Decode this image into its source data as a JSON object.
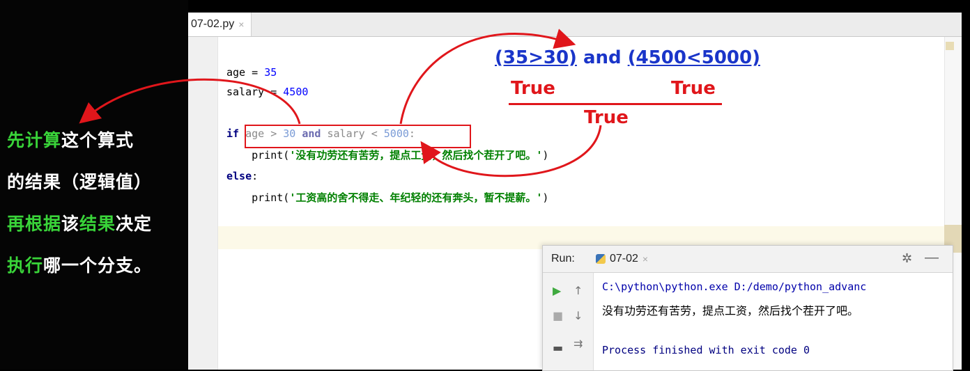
{
  "caption": {
    "line1": {
      "hl": "先计算",
      "rest": "这个算式"
    },
    "line2": {
      "text": "的结果（逻辑值）"
    },
    "line3": {
      "hl1": "再根据",
      "mid": "该",
      "hl2": "结果",
      "rest": "决定"
    },
    "line4": {
      "hl": "执行",
      "rest": "哪一个分支。"
    }
  },
  "editor": {
    "tab_label": "07-02.py",
    "tab_close": "×",
    "lines": {
      "l1_var": "age = ",
      "l1_num": "35",
      "l2_var": "salary = ",
      "l2_num": "4500",
      "l3_if": "if",
      "l3_c1": "age > ",
      "l3_n1": "30",
      "l3_and": " and ",
      "l3_c2": "salary < ",
      "l3_n2": "5000",
      "l3_colon": ":",
      "l4_print": "    print(",
      "l4_str": "'没有功劳还有苦劳，提点工资，然后找个茬开了吧。'",
      "l4_end": ")",
      "l5_else": "else",
      "l5_colon": ":",
      "l6_print": "    print(",
      "l6_str": "'工资高的舍不得走、年纪轻的还有奔头，暂不提薪。'",
      "l6_end": ")"
    }
  },
  "annotations": {
    "expr1": "(35>30)",
    "and": " and ",
    "expr2": "(4500<5000)",
    "true1": "True",
    "true2": "True",
    "true3": "True"
  },
  "run_panel": {
    "label": "Run:",
    "tab": "07-02",
    "tab_close": "×",
    "gear": "✲",
    "minimize": "—",
    "console_path": "C:\\python\\python.exe D:/demo/python_advanc",
    "console_output": "没有功劳还有苦劳，提点工资，然后找个茬开了吧。",
    "console_exit": "Process finished with exit code 0"
  },
  "colors": {
    "annotation_red": "#e0161b",
    "annotation_blue": "#1a35c9",
    "caption_highlight": "#39d439"
  }
}
